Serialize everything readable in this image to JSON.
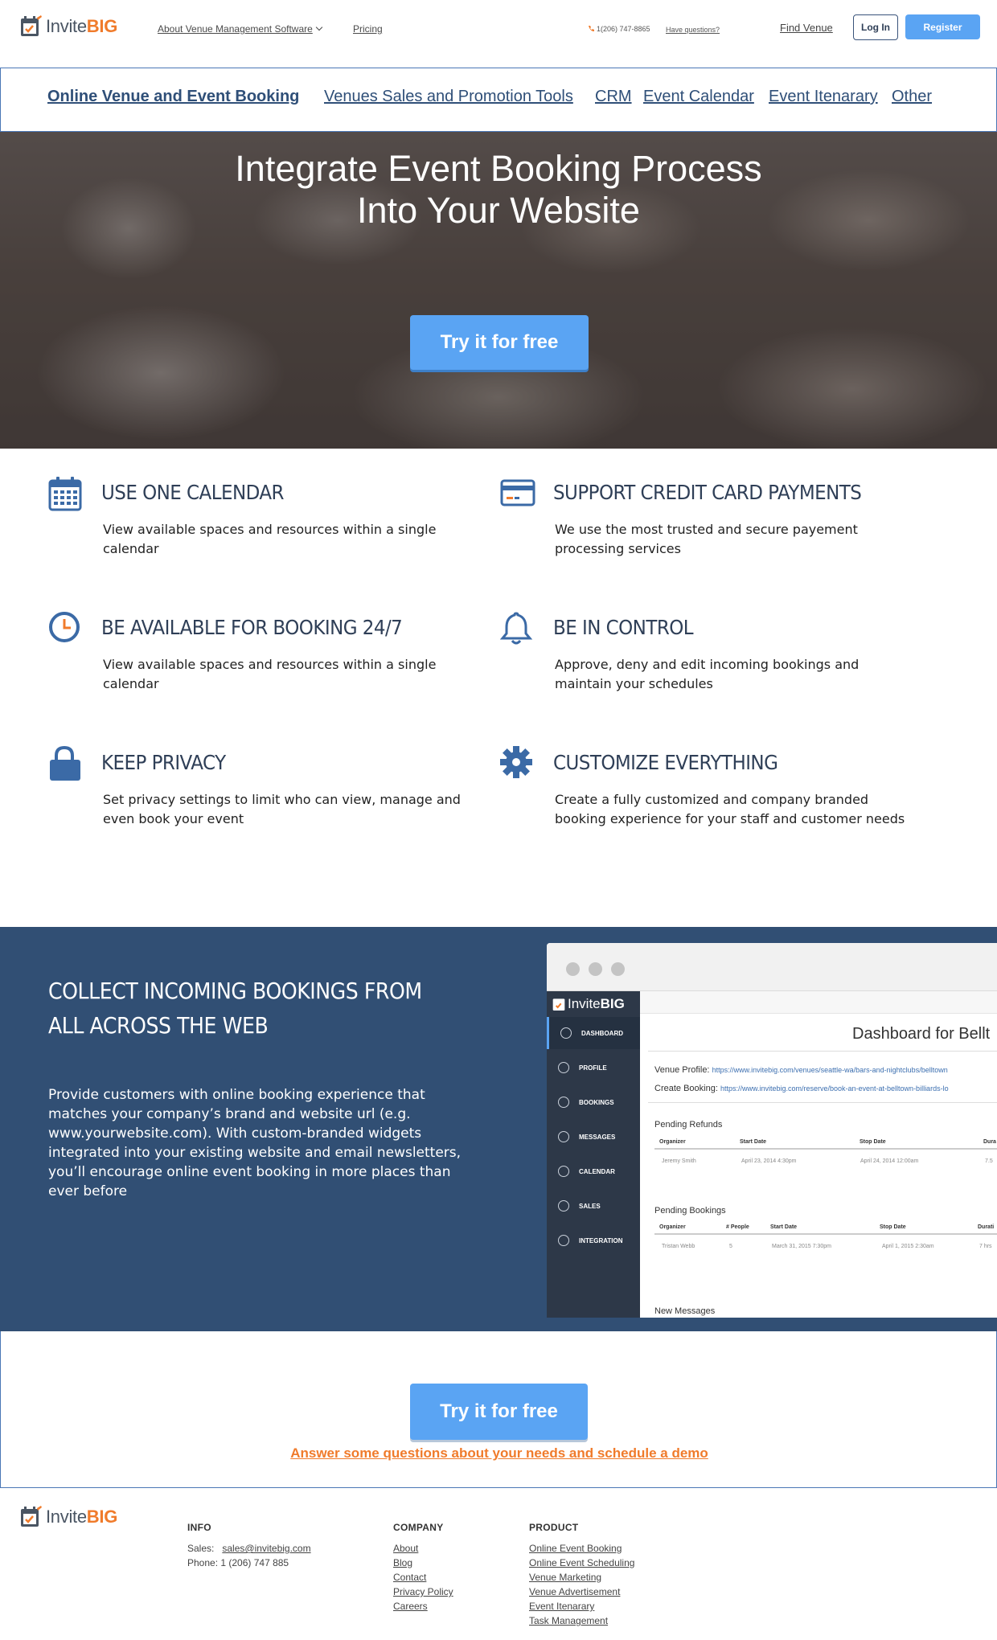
{
  "header": {
    "logo": {
      "part1": "Invite",
      "part2": "BIG"
    },
    "nav": {
      "about": "About Venue Management Software",
      "pricing": "Pricing"
    },
    "phone": "1(206) 747-8865",
    "have_questions": "Have questions?",
    "find_venue": "Find Venue",
    "login": "Log In",
    "register": "Register"
  },
  "subnav": {
    "items": [
      {
        "label": "Online Venue and Event Booking",
        "active": true
      },
      {
        "label": "Venues Sales and Promotion Tools"
      },
      {
        "label": "CRM"
      },
      {
        "label": "Event Calendar"
      },
      {
        "label": "Event Itenarary"
      },
      {
        "label": "Other"
      }
    ]
  },
  "hero": {
    "title_line1": "Integrate Event Booking Process",
    "title_line2": "Into Your Website",
    "cta": "Try it for free"
  },
  "features": [
    {
      "icon": "calendar-icon",
      "title": "USE ONE CALENDAR",
      "text": "View available spaces and resources within a single calendar"
    },
    {
      "icon": "credit-card-icon",
      "title": "SUPPORT CREDIT CARD PAYMENTS",
      "text": "We use the most trusted and secure payement processing services"
    },
    {
      "icon": "clock-icon",
      "title": "BE AVAILABLE FOR BOOKING 24/7",
      "text": "View available spaces and resources within a single calendar"
    },
    {
      "icon": "bell-icon",
      "title": "BE IN CONTROL",
      "text": "Approve, deny and edit incoming bookings and maintain your schedules"
    },
    {
      "icon": "lock-icon",
      "title": "KEEP PRIVACY",
      "text": "Set privacy settings to limit who can view, manage and even book your event"
    },
    {
      "icon": "gear-icon",
      "title": "CUSTOMIZE EVERYTHING",
      "text": "Create a fully customized and company branded booking experience for your staff and customer needs"
    }
  ],
  "collect": {
    "title": "COLLECT INCOMING BOOKINGS FROM ALL ACROSS THE WEB",
    "text": "Provide customers with online booking experience that matches your company’s brand and website url (e.g. www.yourwebsite.com). With custom-branded widgets integrated into your existing website and email newsletters, you’ll encourage online event booking in more places than ever before"
  },
  "dashboard": {
    "logo": {
      "part1": "Invite",
      "part2": "BIG"
    },
    "menu": [
      "DASHBOARD",
      "PROFILE",
      "BOOKINGS",
      "MESSAGES",
      "CALENDAR",
      "SALES",
      "INTEGRATION"
    ],
    "title": "Dashboard for Bellt",
    "venue_profile_label": "Venue Profile:",
    "venue_profile_url": "https://www.invitebig.com/venues/seattle-wa/bars-and-nightclubs/belltown",
    "create_booking_label": "Create Booking:",
    "create_booking_url": "https://www.invitebig.com/reserve/book-an-event-at-belltown-billiards-lo",
    "pending_refunds": {
      "heading": "Pending Refunds",
      "columns": [
        "Organizer",
        "Start Date",
        "Stop Date",
        "Dura"
      ],
      "row": [
        "Jeremy Smith",
        "April 23, 2014 4:30pm",
        "April 24, 2014 12:00am",
        "7.5"
      ]
    },
    "pending_bookings": {
      "heading": "Pending Bookings",
      "columns": [
        "Organizer",
        "# People",
        "Start Date",
        "Stop Date",
        "Durati"
      ],
      "row": [
        "Tristan Webb",
        "5",
        "March 31, 2015 7:30pm",
        "April 1, 2015 2:30am",
        "7 hrs"
      ]
    },
    "new_messages": "New Messages"
  },
  "cta": {
    "button": "Try it for free",
    "demo_link": "Answer some questions about your needs and schedule a demo"
  },
  "footer": {
    "logo": {
      "part1": "Invite",
      "part2": "BIG"
    },
    "info": {
      "heading": "INFO",
      "sales_label": "Sales:",
      "sales_email": "sales@invitebig.com",
      "phone": "Phone: 1 (206) 747 885"
    },
    "company": {
      "heading": "COMPANY",
      "links": [
        "About",
        "Blog",
        "Contact",
        "Privacy Policy",
        "Careers"
      ]
    },
    "product": {
      "heading": "PRODUCT",
      "links": [
        "Online Event Booking",
        "Online Event Scheduling",
        "Venue Marketing",
        "Venue Advertisement",
        "Event Itenarary",
        "Task Management"
      ]
    }
  },
  "colors": {
    "primary_blue": "#5aa4f3",
    "navy": "#314f74",
    "orange": "#f07b2b",
    "text_dark": "#2f3f57"
  }
}
